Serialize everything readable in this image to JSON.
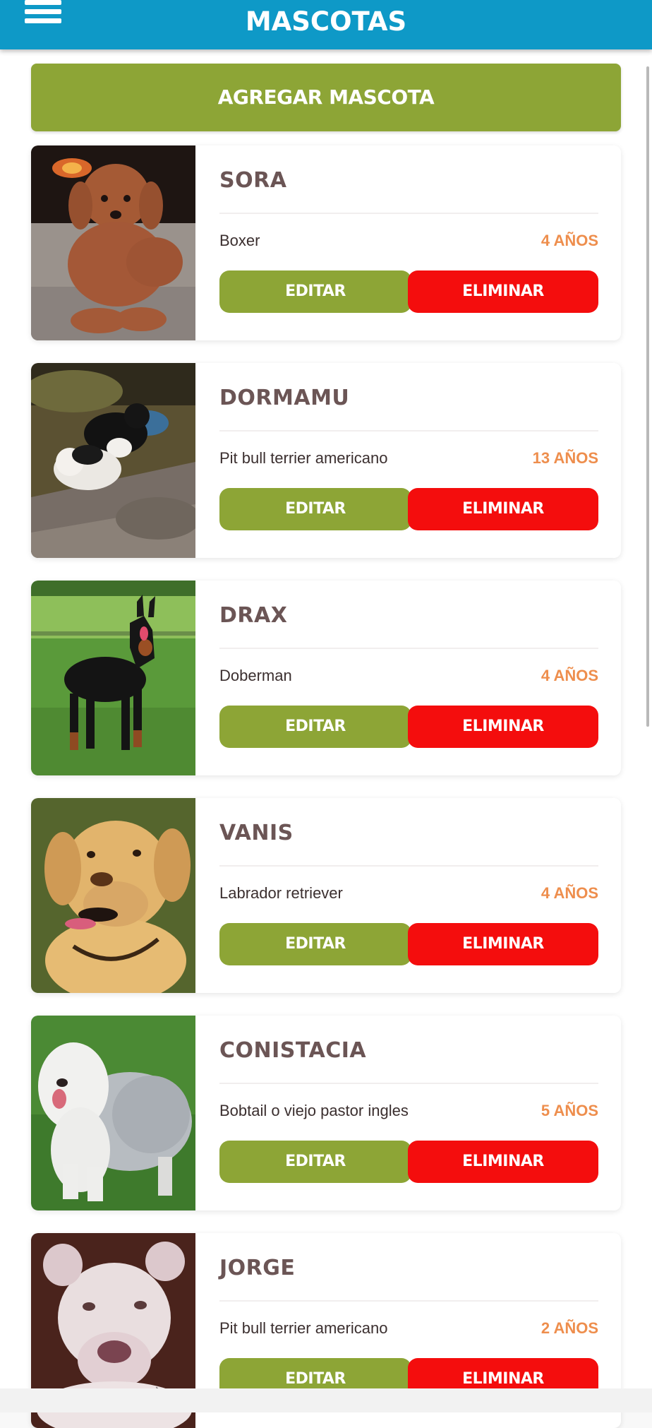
{
  "header": {
    "title": "MASCOTAS",
    "background_color": "#0e99c7",
    "menu_icon": "hamburger-menu-icon"
  },
  "main": {
    "add_button_label": "AGREGAR MASCOTA",
    "pets": [
      {
        "name": "SORA",
        "breed": "Boxer",
        "age": "4 AÑOS",
        "photo": "brown poodle lying by fireplace",
        "edit_label": "EDITAR",
        "delete_label": "ELIMINAR"
      },
      {
        "name": "DORMAMU",
        "breed": "Pit bull terrier americano",
        "age": "13 AÑOS",
        "photo": "black and white puppies on dirt",
        "edit_label": "EDITAR",
        "delete_label": "ELIMINAR"
      },
      {
        "name": "DRAX",
        "breed": "Doberman",
        "age": "4 AÑOS",
        "photo": "doberman standing on grass",
        "edit_label": "EDITAR",
        "delete_label": "ELIMINAR"
      },
      {
        "name": "VANIS",
        "breed": "Labrador retriever",
        "age": "4 AÑOS",
        "photo": "yellow labrador portrait",
        "edit_label": "EDITAR",
        "delete_label": "ELIMINAR"
      },
      {
        "name": "CONISTACIA",
        "breed": "Bobtail o viejo pastor ingles",
        "age": "5 AÑOS",
        "photo": "old english sheepdog on grass",
        "edit_label": "EDITAR",
        "delete_label": "ELIMINAR"
      },
      {
        "name": "JORGE",
        "breed": "Pit bull terrier americano",
        "age": "2 AÑOS",
        "photo": "white pit bull portrait",
        "edit_label": "EDITAR",
        "delete_label": "ELIMINAR"
      }
    ]
  },
  "colors": {
    "accent_green": "#8da536",
    "delete_red": "#f40d0d",
    "age_orange": "#ee8e4d",
    "name_brown": "#6b5555"
  }
}
